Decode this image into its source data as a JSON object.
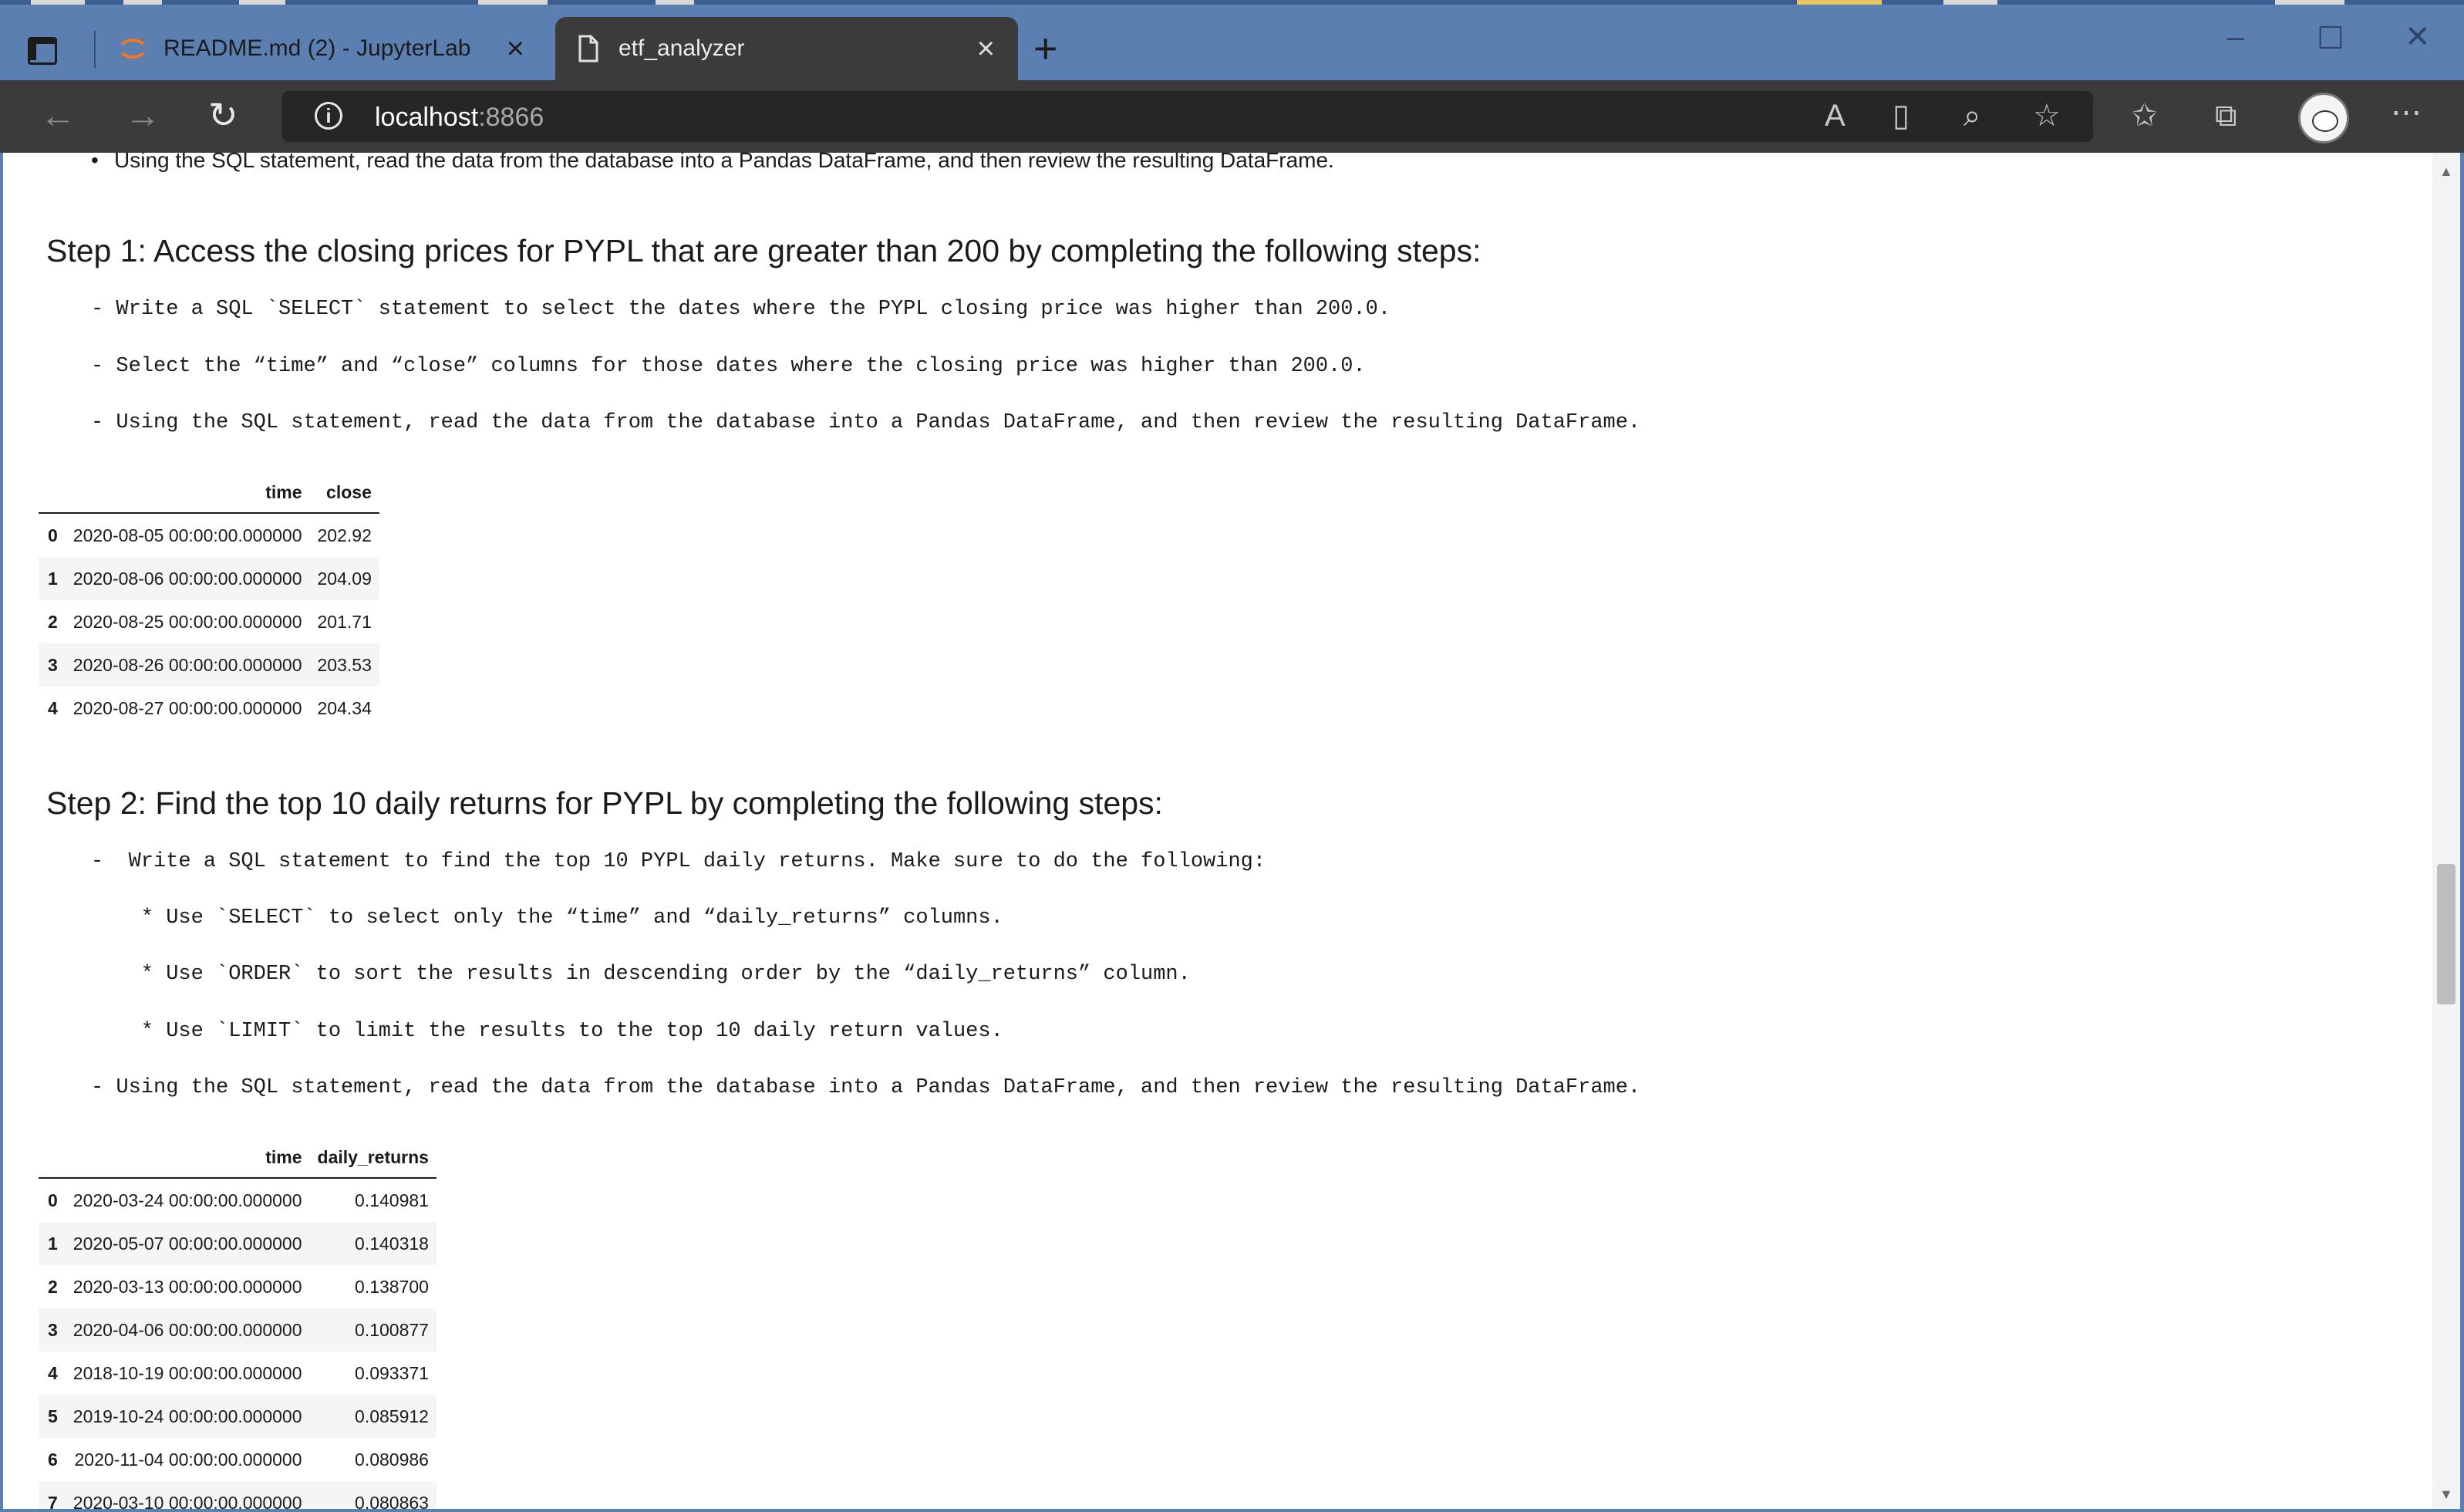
{
  "browser": {
    "tabs": [
      {
        "title": "README.md (2) - JupyterLab",
        "icon": "jupyter-icon",
        "active": false
      },
      {
        "title": "etf_analyzer",
        "icon": "page-icon",
        "active": true
      }
    ],
    "url_host": "localhost",
    "url_port": ":8866"
  },
  "notebook": {
    "top_bullet": "Using the SQL statement, read the data from the database into a Pandas DataFrame, and then review the resulting DataFrame.",
    "step1": {
      "heading": "Step 1: Access the closing prices for PYPL that are greater than 200 by completing the following steps:",
      "lines": [
        "- Write a SQL `SELECT` statement to select the dates where the PYPL closing price was higher than 200.0.",
        "- Select the “time” and “close” columns for those dates where the closing price was higher than 200.0.",
        "- Using the SQL statement, read the data from the database into a Pandas DataFrame, and then review the resulting DataFrame."
      ],
      "table": {
        "columns": [
          "",
          "time",
          "close"
        ],
        "rows": [
          [
            "0",
            "2020-08-05 00:00:00.000000",
            "202.92"
          ],
          [
            "1",
            "2020-08-06 00:00:00.000000",
            "204.09"
          ],
          [
            "2",
            "2020-08-25 00:00:00.000000",
            "201.71"
          ],
          [
            "3",
            "2020-08-26 00:00:00.000000",
            "203.53"
          ],
          [
            "4",
            "2020-08-27 00:00:00.000000",
            "204.34"
          ]
        ]
      }
    },
    "step2": {
      "heading": "Step 2: Find the top 10 daily returns for PYPL by completing the following steps:",
      "lines": [
        "-  Write a SQL statement to find the top 10 PYPL daily returns. Make sure to do the following:",
        "    * Use `SELECT` to select only the “time” and “daily_returns” columns.",
        "    * Use `ORDER` to sort the results in descending order by the “daily_returns” column.",
        "    * Use `LIMIT` to limit the results to the top 10 daily return values.",
        "- Using the SQL statement, read the data from the database into a Pandas DataFrame, and then review the resulting DataFrame."
      ],
      "table": {
        "columns": [
          "",
          "time",
          "daily_returns"
        ],
        "rows": [
          [
            "0",
            "2020-03-24 00:00:00.000000",
            "0.140981"
          ],
          [
            "1",
            "2020-05-07 00:00:00.000000",
            "0.140318"
          ],
          [
            "2",
            "2020-03-13 00:00:00.000000",
            "0.138700"
          ],
          [
            "3",
            "2020-04-06 00:00:00.000000",
            "0.100877"
          ],
          [
            "4",
            "2018-10-19 00:00:00.000000",
            "0.093371"
          ],
          [
            "5",
            "2019-10-24 00:00:00.000000",
            "0.085912"
          ],
          [
            "6",
            "2020-11-04 00:00:00.000000",
            "0.080986"
          ],
          [
            "7",
            "2020-03-10 00:00:00.000000",
            "0.080863"
          ]
        ]
      }
    }
  }
}
